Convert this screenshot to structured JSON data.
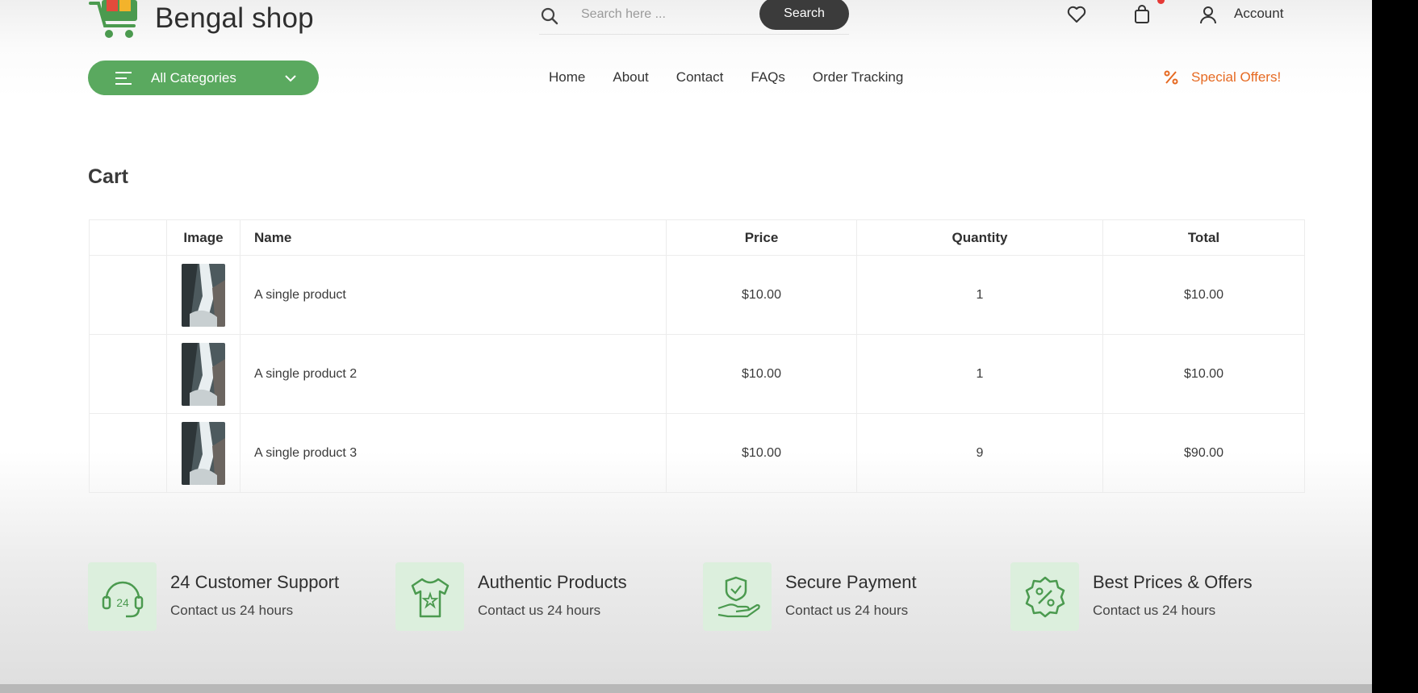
{
  "header": {
    "brand": "Bengal shop",
    "search": {
      "placeholder": "Search here ...",
      "button_label": "Search"
    },
    "account_label": "Account",
    "icons": [
      "search-icon",
      "heart-icon",
      "bag-icon",
      "user-icon"
    ]
  },
  "nav": {
    "categories_label": "All Categories",
    "links": [
      "Home",
      "About",
      "Contact",
      "FAQs",
      "Order Tracking"
    ],
    "special_offers": "Special Offers!"
  },
  "cart": {
    "title": "Cart",
    "columns": [
      "",
      "Image",
      "Name",
      "Price",
      "Quantity",
      "Total"
    ],
    "rows": [
      {
        "name": "A single product",
        "price": "$10.00",
        "quantity": "1",
        "total": "$10.00"
      },
      {
        "name": "A single product 2",
        "price": "$10.00",
        "quantity": "1",
        "total": "$10.00"
      },
      {
        "name": "A single product 3",
        "price": "$10.00",
        "quantity": "9",
        "total": "$90.00"
      }
    ]
  },
  "features": [
    {
      "title": "24 Customer Support",
      "subtitle": "Contact us 24 hours",
      "icon": "headset-24-icon"
    },
    {
      "title": "Authentic Products",
      "subtitle": "Contact us 24 hours",
      "icon": "tshirt-icon"
    },
    {
      "title": "Secure Payment",
      "subtitle": "Contact us 24 hours",
      "icon": "secure-payment-icon"
    },
    {
      "title": "Best Prices & Offers",
      "subtitle": "Contact us 24 hours",
      "icon": "percent-badge-icon"
    }
  ],
  "colors": {
    "accent_green": "#5aa95f",
    "offer_orange": "#e66a22",
    "search_button": "#3b3b3b",
    "feature_bg": "#dcefdd"
  }
}
